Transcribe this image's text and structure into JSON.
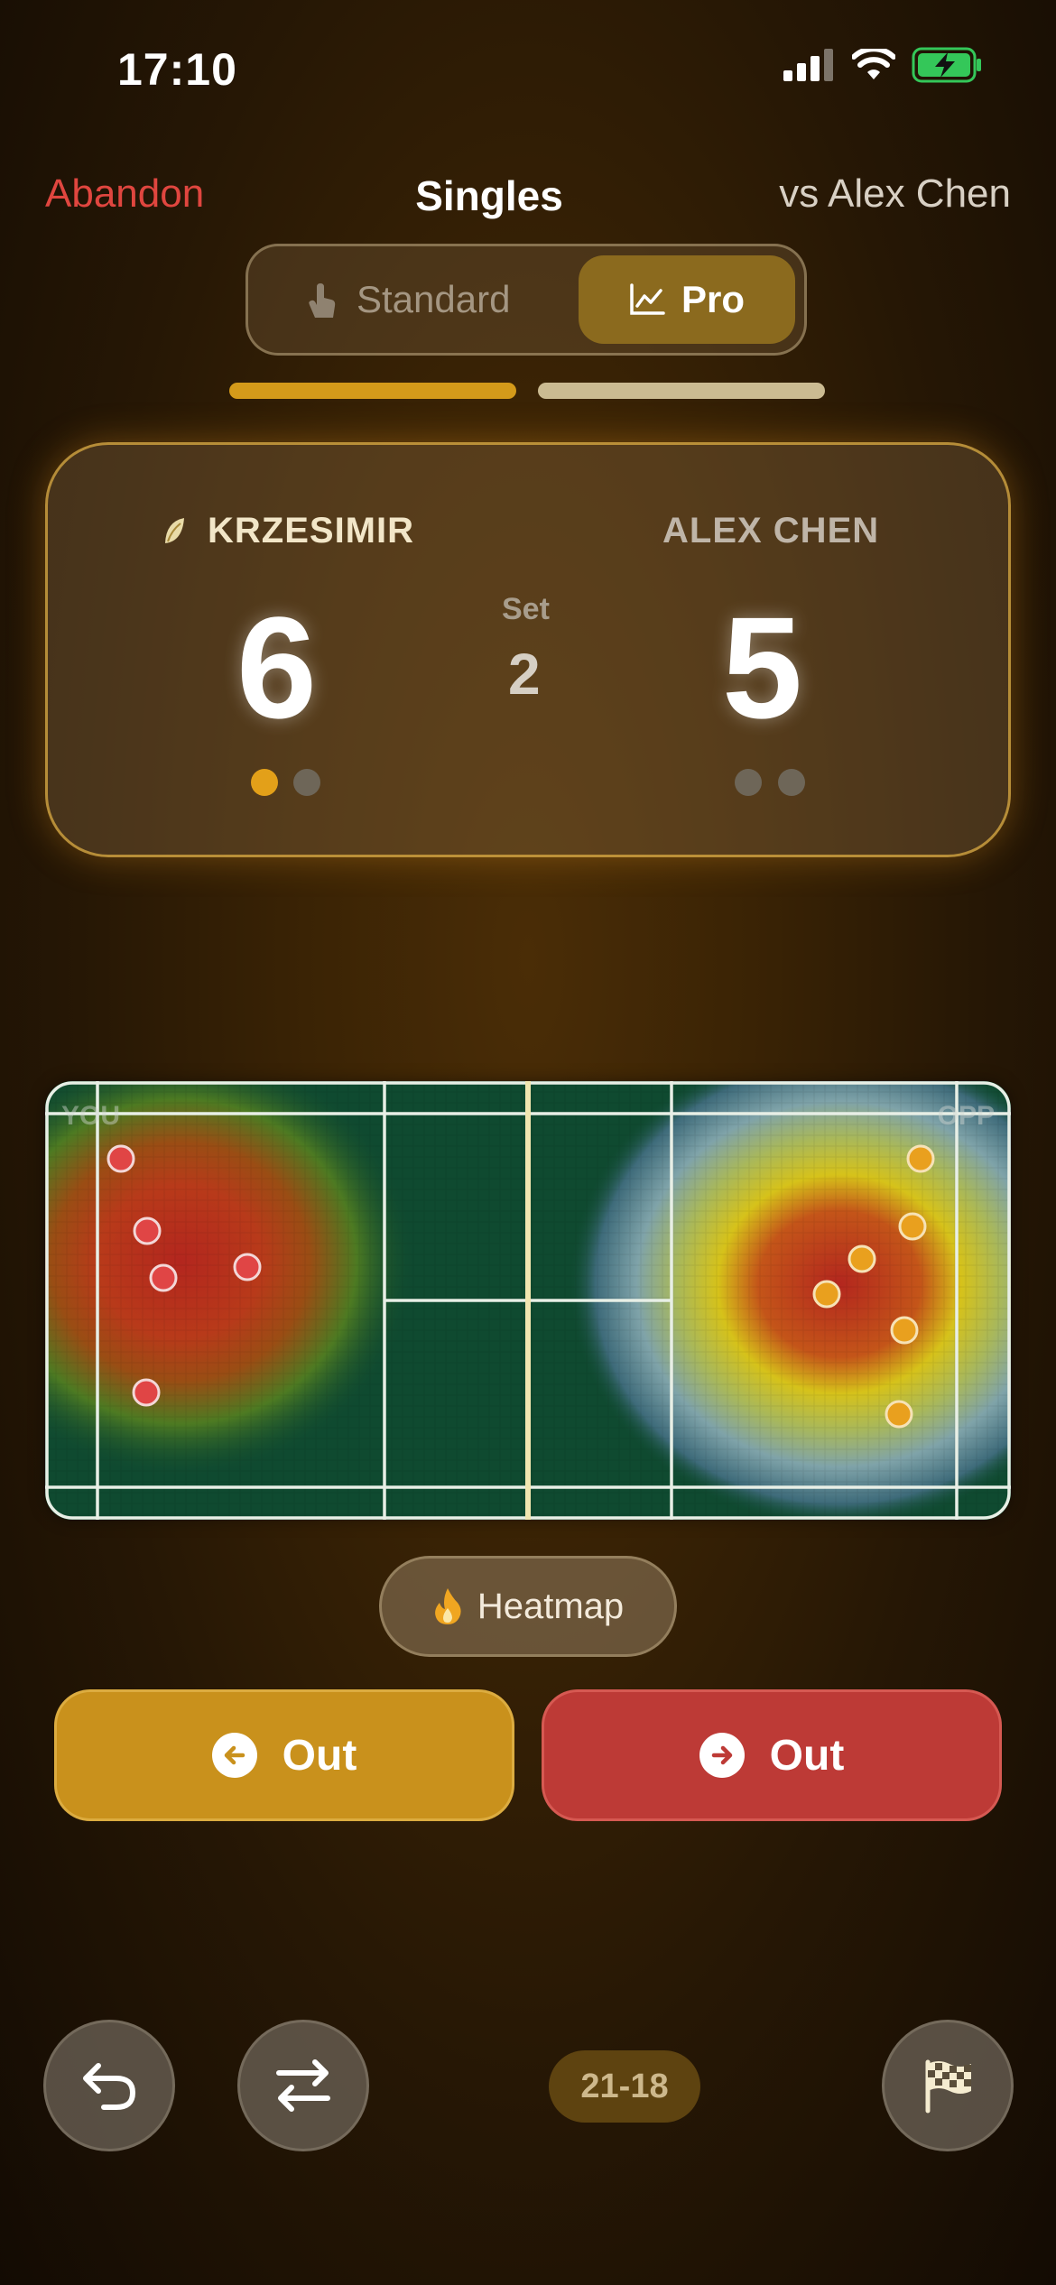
{
  "status_bar": {
    "time": "17:10",
    "icons": [
      "signal-icon",
      "wifi-icon",
      "battery-charging-icon"
    ],
    "battery_color": "#34c759"
  },
  "nav": {
    "abandon_label": "Abandon",
    "title": "Singles",
    "opponent_label": "vs Alex Chen"
  },
  "mode_toggle": {
    "options": [
      {
        "label": "Standard",
        "icon": "tap-icon",
        "selected": false
      },
      {
        "label": "Pro",
        "icon": "chart-line-icon",
        "selected": true
      }
    ]
  },
  "progress": {
    "segment_colors": [
      "#d49a1a",
      "#cbbb92"
    ]
  },
  "scoreboard": {
    "player1": {
      "name": "KRZESIMIR",
      "score": "6",
      "serving_icon": "tennis-ball-icon",
      "sets_won_dots": [
        true,
        false
      ]
    },
    "player2": {
      "name": "ALEX CHEN",
      "score": "5",
      "sets_won_dots": [
        false,
        false
      ]
    },
    "set_label": "Set",
    "set_number": "2"
  },
  "court": {
    "left_label": "YOU",
    "right_label": "OPP",
    "heatmap_colors": {
      "hot": "#b3261e",
      "warm": "#d6c21a",
      "cool": "#3e6b7a"
    }
  },
  "heatmap_toggle": {
    "label": "Heatmap",
    "icon": "flame-icon"
  },
  "actions": {
    "left_out": {
      "label": "Out",
      "icon": "arrow-left-icon",
      "color": "#c9911c"
    },
    "right_out": {
      "label": "Out",
      "icon": "arrow-right-icon",
      "color": "#bd3a36"
    }
  },
  "footer": {
    "undo_icon": "undo-icon",
    "swap_icon": "swap-icon",
    "points_score": "21-18",
    "finish_icon": "checkered-flag-icon"
  }
}
